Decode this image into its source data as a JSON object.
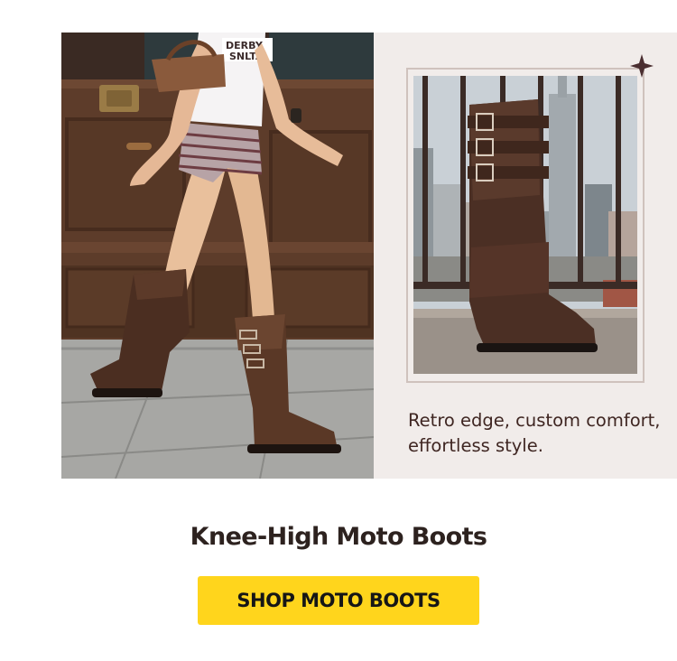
{
  "hero": {
    "left_image_alt": "Woman walking wearing brown suede knee-high moto boots",
    "right_image_alt": "Brown suede knee-high moto boot with three buckles on a city rooftop",
    "tagline": "Retro edge, custom comfort, effortless style.",
    "accent_color": "#3f2622",
    "icon": "star-icon"
  },
  "product": {
    "title": "Knee-High Moto Boots"
  },
  "cta": {
    "label": "SHOP MOTO BOOTS",
    "color": "#ffd51c"
  }
}
